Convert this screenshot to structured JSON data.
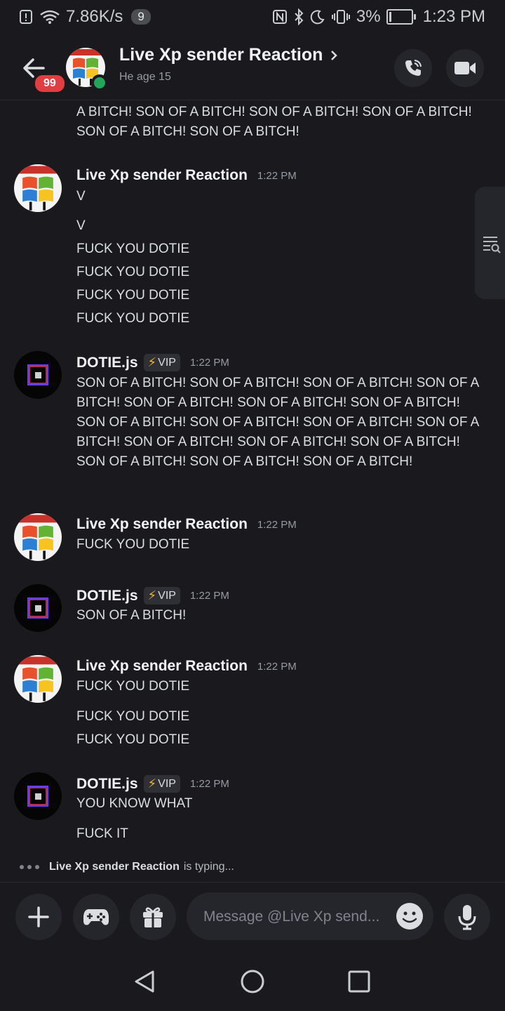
{
  "status_bar": {
    "speed": "7.86K/s",
    "notif_count": "9",
    "battery_pct": "3%",
    "time": "1:23 PM"
  },
  "header": {
    "back_badge": "99",
    "title": "Live Xp sender Reaction",
    "subtitle": "He age 15"
  },
  "messages": {
    "cont_text": "A BITCH! SON OF A BITCH! SON OF A BITCH! SON OF A BITCH! SON OF A BITCH! SON OF A BITCH!",
    "m1": {
      "author": "Live Xp sender Reaction",
      "time": "1:22 PM",
      "lines": [
        "V",
        "V",
        "FUCK YOU DOTIE",
        "FUCK YOU DOTIE",
        "FUCK YOU DOTIE",
        "FUCK YOU DOTIE"
      ]
    },
    "m2": {
      "author": "DOTIE.js",
      "badge": "VIP",
      "time": "1:22 PM",
      "text": "SON OF A BITCH! SON OF A BITCH! SON OF A BITCH! SON OF A BITCH! SON OF A BITCH! SON OF A BITCH! SON OF A BITCH! SON OF A BITCH! SON OF A BITCH! SON OF A BITCH! SON OF A BITCH! SON OF A BITCH! SON OF A BITCH! SON OF A BITCH! SON OF A BITCH! SON OF A BITCH! SON OF A BITCH!"
    },
    "m3": {
      "author": "Live Xp sender Reaction",
      "time": "1:22 PM",
      "lines": [
        "FUCK YOU DOTIE"
      ]
    },
    "m4": {
      "author": "DOTIE.js",
      "badge": "VIP",
      "time": "1:22 PM",
      "lines": [
        "SON OF A BITCH!"
      ]
    },
    "m5": {
      "author": "Live Xp sender Reaction",
      "time": "1:22 PM",
      "lines": [
        "FUCK YOU DOTIE",
        "FUCK YOU DOTIE",
        "FUCK YOU DOTIE"
      ]
    },
    "m6": {
      "author": "DOTIE.js",
      "badge": "VIP",
      "time": "1:22 PM",
      "lines": [
        "YOU KNOW WHAT",
        "FUCK IT"
      ]
    }
  },
  "typing": {
    "who": "Live Xp sender Reaction",
    "suffix": "is typing..."
  },
  "composer": {
    "placeholder": "Message @Live Xp send..."
  },
  "icons": {
    "back": "arrow-left-icon",
    "call": "phone-call-icon",
    "video": "video-camera-icon",
    "plus": "plus-icon",
    "game": "gamepad-icon",
    "gift": "gift-icon",
    "emoji": "emoji-icon",
    "mic": "microphone-icon",
    "search_tab": "search-messages-icon"
  },
  "colors": {
    "background": "#1a1a1e",
    "online": "#23a55a",
    "badge": "#e03e41",
    "vip_bolt": "#f0b232"
  }
}
